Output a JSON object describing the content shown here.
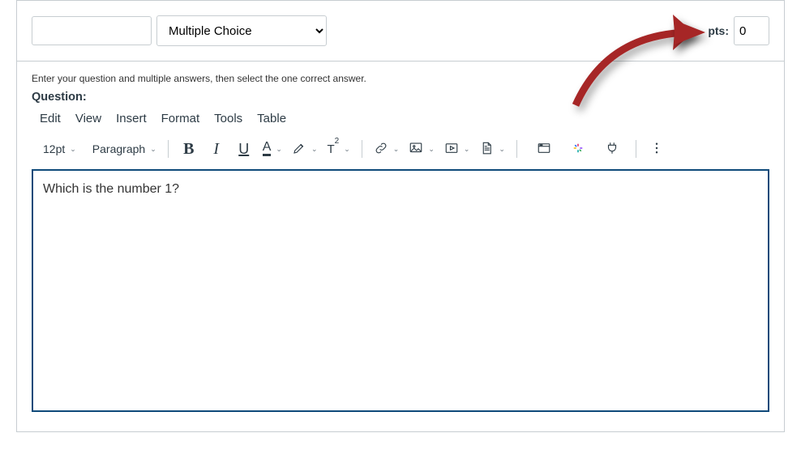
{
  "header": {
    "question_name_value": "",
    "question_type_value": "Multiple Choice",
    "question_type_options": [
      "Multiple Choice"
    ],
    "pts_label": "pts:",
    "pts_value": "0"
  },
  "body": {
    "instruction": "Enter your question and multiple answers, then select the one correct answer.",
    "question_label": "Question:"
  },
  "menubar": {
    "edit": "Edit",
    "view": "View",
    "insert": "Insert",
    "format": "Format",
    "tools": "Tools",
    "table": "Table"
  },
  "toolbar": {
    "font_size_label": "12pt",
    "block_label": "Paragraph",
    "bold_glyph": "B",
    "italic_glyph": "I",
    "underline_glyph": "U",
    "text_color_glyph": "A",
    "superscript_glyph_base": "T",
    "superscript_glyph_sup": "2"
  },
  "editor": {
    "content": "Which is the number 1?"
  }
}
